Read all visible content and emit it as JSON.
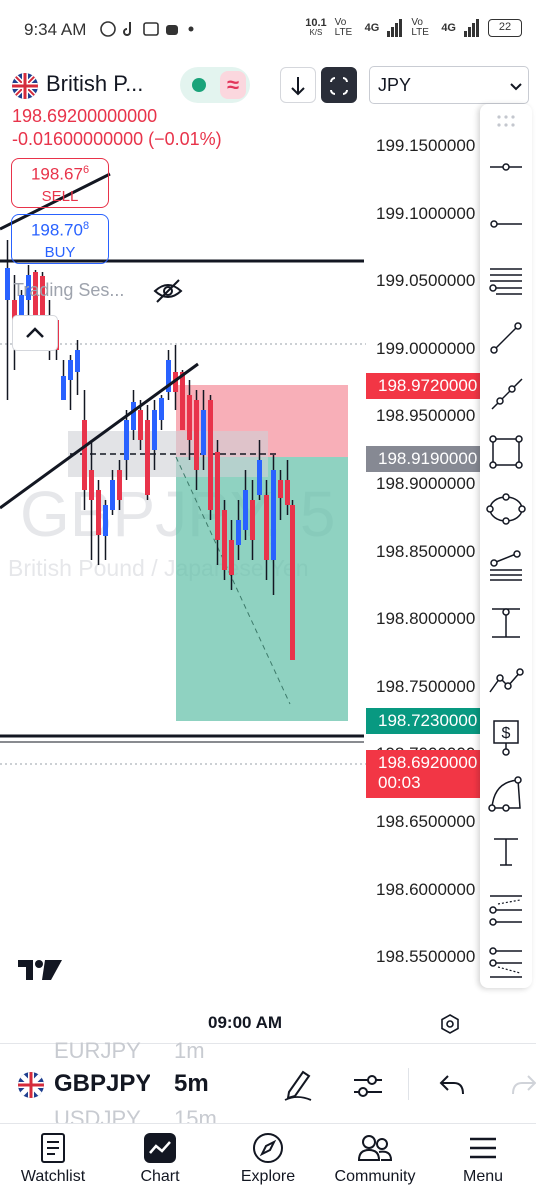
{
  "status_bar": {
    "time": "9:34 AM",
    "speed": "10.1",
    "speed_unit": "K/S",
    "net1": "Vo LTE",
    "net2": "4G",
    "net3": "Vo LTE",
    "net4": "4G",
    "battery": "22"
  },
  "header": {
    "symbol_title": "British P...",
    "currency_select": "JPY",
    "down_arrow_icon": "arrow-down-icon",
    "fullscreen_icon": "fullscreen-icon"
  },
  "quote": {
    "last_price": "198.69200000000",
    "change": "-0.01600000000 (−0.01%)",
    "sell_price": "198.67",
    "sell_sup": "6",
    "sell_label": "SELL",
    "buy_price": "198.70",
    "buy_sup": "8",
    "buy_label": "BUY"
  },
  "session": {
    "label": "Trading Ses..."
  },
  "chart": {
    "watermark_symbol": "GBPJPY, 5",
    "watermark_desc": "British Pound / Japanese Yen",
    "axis_labels": [
      "199.1500000",
      "199.1000000",
      "199.0500000",
      "199.0000000",
      "198.9500000",
      "198.9000000",
      "198.8500000",
      "198.8000000",
      "198.7500000",
      "198.7000000",
      "198.6500000",
      "198.6000000",
      "198.5500000"
    ],
    "stop_tag": "198.9720000",
    "entry_tag": "198.9190000",
    "target_tag": "198.7230000",
    "current_tag": "198.6920000",
    "current_countdown": "00:03",
    "time_label": "09:00 AM",
    "colors": {
      "up": "#2962ff",
      "down": "#e8334a",
      "stop_zone": "#f7a1ac",
      "target_zone": "#5fbfa7"
    }
  },
  "subbar": {
    "symbol_prev": "EURJPY",
    "symbol": "GBPJPY",
    "symbol_next": "USDJPY",
    "tf_prev": "1m",
    "timeframe": "5m",
    "tf_next": "15m"
  },
  "nav": [
    {
      "label": "Watchlist",
      "icon": "watchlist-icon"
    },
    {
      "label": "Chart",
      "icon": "chart-icon"
    },
    {
      "label": "Explore",
      "icon": "compass-icon"
    },
    {
      "label": "Community",
      "icon": "community-icon"
    },
    {
      "label": "Menu",
      "icon": "menu-icon"
    }
  ]
}
